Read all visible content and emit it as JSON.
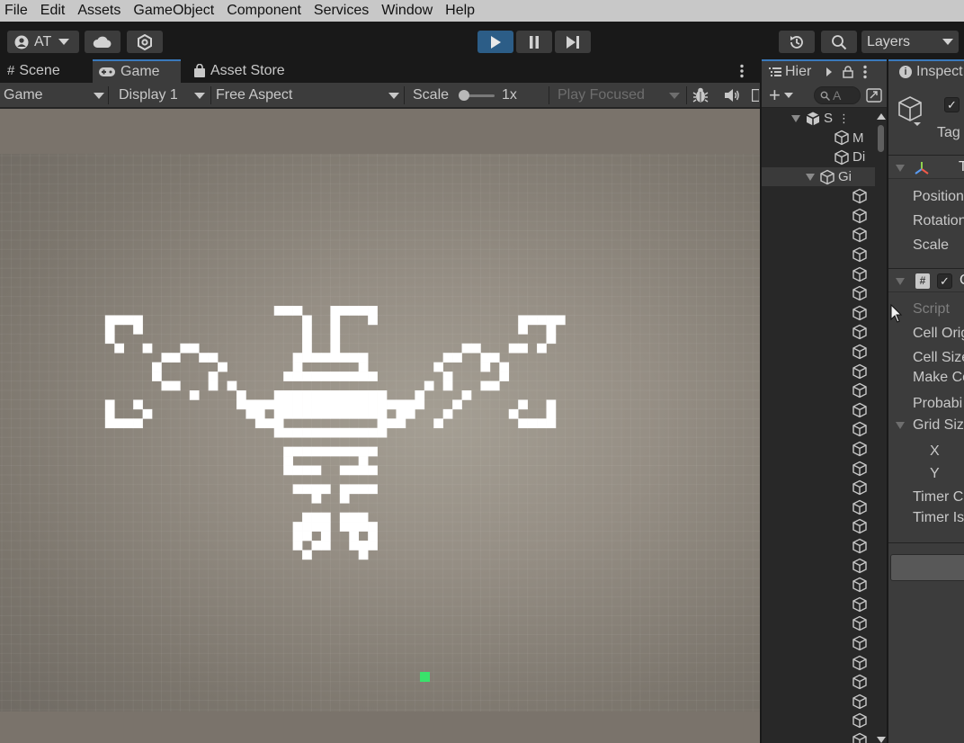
{
  "menu": [
    "File",
    "Edit",
    "Assets",
    "GameObject",
    "Component",
    "Services",
    "Window",
    "Help"
  ],
  "toolbar": {
    "account_label": "AT",
    "layers_label": "Layers",
    "accent_color": "#3a79bb"
  },
  "game_window": {
    "tabs": [
      {
        "label": "Scene",
        "icon": "grid-icon",
        "active": false
      },
      {
        "label": "Game",
        "icon": "gamepad-icon",
        "active": true
      },
      {
        "label": "Asset Store",
        "icon": "shopping-bag-icon",
        "active": false
      }
    ],
    "controls": {
      "view_mode": "Game",
      "display": "Display 1",
      "aspect": "Free Aspect",
      "scale_label": "Scale",
      "scale_value": "1x",
      "play_mode": "Play Focused"
    }
  },
  "hierarchy": {
    "tab_label": "Hier",
    "search_placeholder": "A",
    "rows": [
      {
        "label": "S",
        "icon": "unity-scene-icon",
        "depth": 0
      },
      {
        "label": "M",
        "icon": "cube-icon",
        "depth": 1
      },
      {
        "label": "Di",
        "icon": "cube-icon",
        "depth": 1
      },
      {
        "label": "Gi",
        "icon": "cube-icon",
        "depth": 1,
        "selected": true
      }
    ],
    "child_cube_count": 29
  },
  "inspector": {
    "tab_label": "Inspect",
    "tag_label": "Tag",
    "transform_fields": [
      "Position",
      "Rotation",
      "Scale"
    ],
    "script_label": "Script",
    "script_fields": [
      "Cell Orig",
      "Cell Size",
      "Make Co",
      "Probabi",
      "Grid Siz",
      "X",
      "Y",
      "Timer C",
      "Timer Is"
    ]
  }
}
